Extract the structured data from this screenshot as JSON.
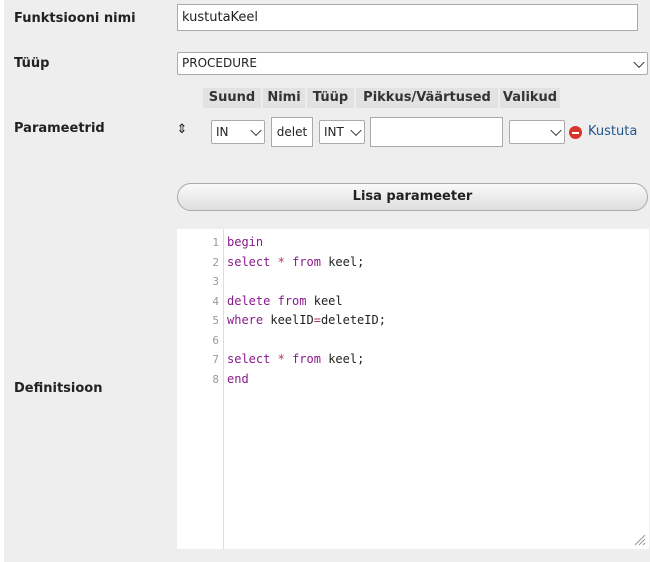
{
  "labels": {
    "function_name": "Funktsiooni nimi",
    "type": "Tüüp",
    "params": "Parameetrid",
    "definition": "Definitsioon"
  },
  "function_name_value": "kustutaKeel",
  "type_select": {
    "selected": "PROCEDURE"
  },
  "param_headers": {
    "direction": "Suund",
    "name": "Nimi",
    "type": "Tüüp",
    "length": "Pikkus/Väärtused",
    "options": "Valikud"
  },
  "param_row": {
    "drag_glyph": "⇕",
    "direction": "IN",
    "name": "delet",
    "type": "INT",
    "length": "",
    "options": "",
    "delete_label": "Kustuta"
  },
  "add_param_button": "Lisa parameeter",
  "code_lines": [
    {
      "n": "1",
      "text": "begin"
    },
    {
      "n": "2",
      "text": "select * from keel;"
    },
    {
      "n": "3",
      "text": ""
    },
    {
      "n": "4",
      "text": "delete from keel"
    },
    {
      "n": "5",
      "text": "where keelID=deleteID;"
    },
    {
      "n": "6",
      "text": ""
    },
    {
      "n": "7",
      "text": "select * from keel;"
    },
    {
      "n": "8",
      "text": "end"
    }
  ],
  "icons": {
    "delete": "minus-circle-icon",
    "resize": "resize-grip-icon",
    "drag": "drag-handle-icon"
  },
  "colors": {
    "keyword": "#8a1a8a",
    "operator": "#b03060",
    "delete_icon": "#d9342b"
  }
}
